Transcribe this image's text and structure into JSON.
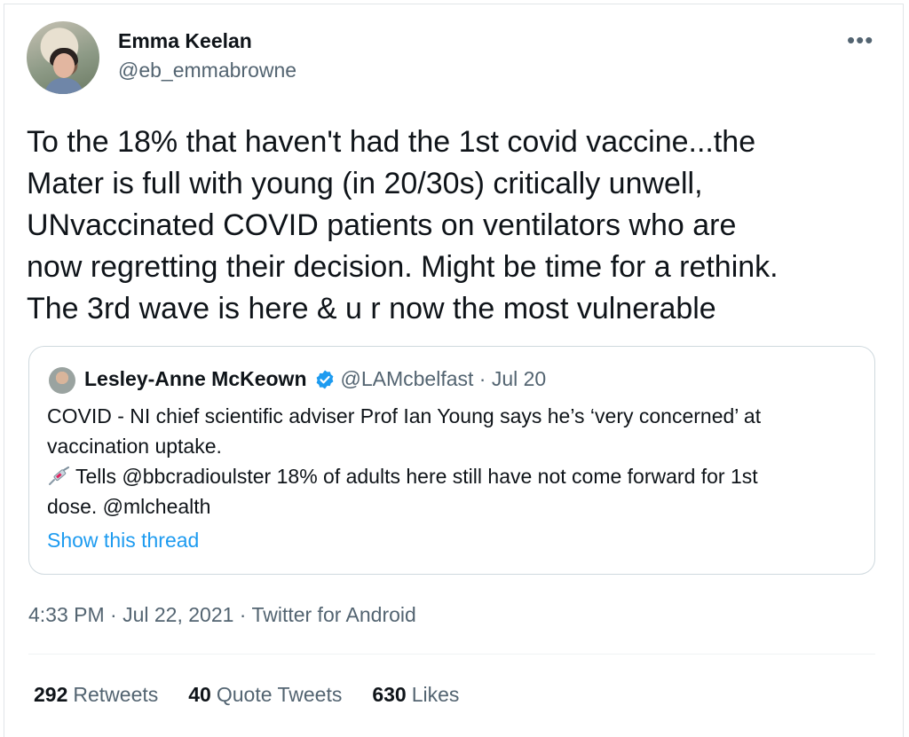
{
  "tweet": {
    "author_name": "Emma Keelan",
    "author_handle": "@eb_emmabrowne",
    "more_icon": "•••",
    "text_lines": [
      "To the 18% that haven't had the 1st covid vaccine...the",
      "Mater is full with young (in 20/30s) critically unwell,",
      "UNvaccinated COVID patients on ventilators who are",
      "now regretting their decision. Might be time for a rethink.",
      "The 3rd wave is here & u r now the most vulnerable"
    ],
    "timestamp": "4:33 PM · Jul 22, 2021 · Twitter for Android"
  },
  "quote": {
    "author_name": "Lesley-Anne McKeown",
    "meta": "@LAMcbelfast · Jul 20",
    "body_lines": [
      "COVID - NI chief scientific adviser Prof Ian Young says he’s ‘very concerned’ at",
      "vaccination uptake.",
      "Tells @bbcradioulster 18% of adults here still have not come forward for 1st",
      "dose. @mlchealth"
    ],
    "syringe_icon": "syringe-icon",
    "show_thread": "Show this thread"
  },
  "stats": {
    "retweets_count": "292",
    "retweets_label": "Retweets",
    "quotes_count": "40",
    "quotes_label": "Quote Tweets",
    "likes_count": "630",
    "likes_label": "Likes"
  },
  "colors": {
    "link": "#1d9bf0",
    "secondary_text": "#536471",
    "verified_badge": "#1d9bf0"
  }
}
